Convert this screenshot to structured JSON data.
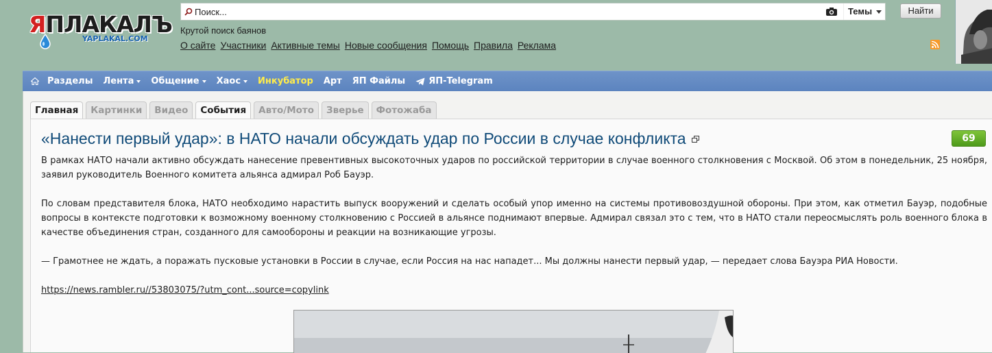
{
  "logo": {
    "brand_prefix": "Я",
    "brand_rest": "ПЛАКАЛЪ",
    "domain": "YAPLAKAL.COM"
  },
  "search": {
    "placeholder": "Поиск...",
    "scope": "Темы",
    "button": "Найти"
  },
  "tagline": "Крутой поиск баянов",
  "top_links": [
    "О сайте",
    "Участники",
    "Активные темы",
    "Новые сообщения",
    "Помощь",
    "Правила",
    "Реклама"
  ],
  "nav": {
    "items": [
      {
        "label": "Разделы",
        "dropdown": false
      },
      {
        "label": "Лента",
        "dropdown": true
      },
      {
        "label": "Общение",
        "dropdown": true
      },
      {
        "label": "Хаос",
        "dropdown": true
      },
      {
        "label": "Инкубатор",
        "dropdown": false,
        "highlight": "#ffec4a"
      },
      {
        "label": "Арт",
        "dropdown": false
      },
      {
        "label": "ЯП Файлы",
        "dropdown": false
      },
      {
        "label": "ЯП-Telegram",
        "dropdown": false,
        "icon": "telegram-icon"
      }
    ]
  },
  "tabs": [
    {
      "label": "Главная",
      "active": true
    },
    {
      "label": "Картинки",
      "active": false
    },
    {
      "label": "Видео",
      "active": false
    },
    {
      "label": "События",
      "active": true
    },
    {
      "label": "Авто/Мото",
      "active": false
    },
    {
      "label": "Зверье",
      "active": false
    },
    {
      "label": "Фотожаба",
      "active": false
    }
  ],
  "post": {
    "title": "«Нанести первый удар»: в НАТО начали обсуждать удар по России в случае конфликта",
    "score": "69",
    "paragraphs": [
      "В рамках НАТО начали активно обсуждать нанесение превентивных высокоточных ударов по российской территории в случае военного столкновения с Москвой. Об этом в понедельник, 25 ноября, заявил руководитель Военного комитета альянса адмирал Роб Бауэр.",
      "По словам представителя блока, НАТО необходимо нарастить выпуск вооружений и сделать особый упор именно на системы противовоздушной обороны. При этом, как отметил Бауэр, подобные вопросы в контексте подготовки к возможному военному столкновению с Россией в альянсе поднимают впервые. Адмирал связал это с тем, что в НАТО стали переосмыслять роль военного блока в качестве объединения стран, созданного для самообороны и реакции на возникающие угрозы.",
      "— Грамотнее не ждать, а поражать пусковые установки в России в случае, если Россия на нас нападет... Мы должны нанести первый удар, — передает слова Бауэра РИА Новости."
    ],
    "link": "https://news.rambler.ru//53803075/?utm_cont...source=copylink"
  },
  "colors": {
    "page_bg": "#9cbaa8",
    "nav_bg": "#6089c2",
    "title": "#0f4a78",
    "score_bg": "#5fa824"
  }
}
